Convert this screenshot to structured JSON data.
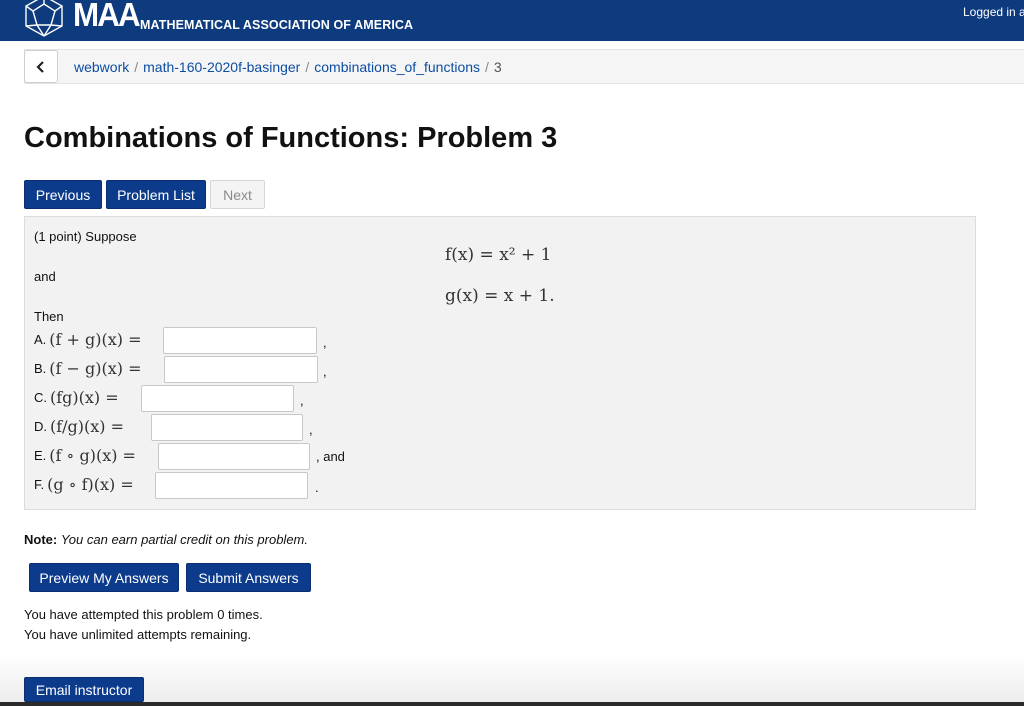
{
  "header": {
    "logo_text": "MAA",
    "org_name": "MATHEMATICAL ASSOCIATION OF AMERICA",
    "login_text": "Logged in a",
    "logo_icon": "maa-polyhedron-logo"
  },
  "breadcrumb": {
    "back_icon": "chevron-left-icon",
    "items": [
      "webwork",
      "math-160-2020f-basinger",
      "combinations_of_functions"
    ],
    "current": "3",
    "separator": "/"
  },
  "page": {
    "title": "Combinations of Functions: Problem 3"
  },
  "nav": {
    "previous": "Previous",
    "problem_list": "Problem List",
    "next": "Next"
  },
  "problem": {
    "intro": "(1 point) Suppose",
    "and_text": "and",
    "then_text": "Then",
    "f_def": "f(x) = x² + 1",
    "g_def": "g(x) = x + 1.",
    "parts": [
      {
        "letter": "A.",
        "expr": "(f + g)(x) =",
        "value": "",
        "after": ","
      },
      {
        "letter": "B.",
        "expr": "(f − g)(x) =",
        "value": "",
        "after": ","
      },
      {
        "letter": "C.",
        "expr": "(fg)(x) =",
        "value": "",
        "after": ","
      },
      {
        "letter": "D.",
        "expr": "(f/g)(x) =",
        "value": "",
        "after": ","
      },
      {
        "letter": "E.",
        "expr": "(f ∘ g)(x) =",
        "value": "",
        "after": ", and"
      },
      {
        "letter": "F.",
        "expr": "(g ∘ f)(x) =",
        "value": "",
        "after": "."
      }
    ]
  },
  "note": {
    "label": "Note:",
    "text": "You can earn partial credit on this problem."
  },
  "actions": {
    "preview": "Preview My Answers",
    "submit": "Submit Answers"
  },
  "status": {
    "attempted": "You have attempted this problem 0 times.",
    "remaining": "You have unlimited attempts remaining."
  },
  "email": {
    "label": "Email instructor"
  },
  "colors": {
    "header_bg": "#0e3a7e",
    "button_bg": "#0c3b8c",
    "link": "#0d4ea3",
    "panel_bg": "#f2f2f2"
  }
}
